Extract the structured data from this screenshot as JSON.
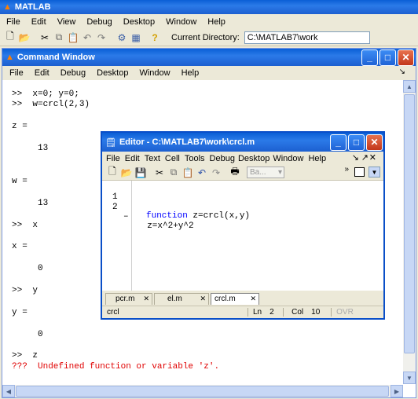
{
  "app": {
    "title": "MATLAB",
    "menu": [
      "File",
      "Edit",
      "View",
      "Debug",
      "Desktop",
      "Window",
      "Help"
    ],
    "current_directory_label": "Current Directory:",
    "current_directory_value": "C:\\MATLAB7\\work"
  },
  "command_window": {
    "title": "Command Window",
    "menu": [
      "File",
      "Edit",
      "Debug",
      "Desktop",
      "Window",
      "Help"
    ],
    "lines": [
      {
        "text": ">>  x=0; y=0;"
      },
      {
        "text": ">>  w=crcl(2,3)"
      },
      {
        "text": "z ="
      },
      {
        "text": "     13"
      },
      {
        "text": "w ="
      },
      {
        "text": "     13"
      },
      {
        "text": ">>  x"
      },
      {
        "text": "x ="
      },
      {
        "text": "     0"
      },
      {
        "text": ">>  y"
      },
      {
        "text": "y ="
      },
      {
        "text": "     0"
      },
      {
        "text": ">>  z"
      },
      {
        "text": "???  Undefined function or variable 'z'."
      }
    ]
  },
  "editor": {
    "title": "Editor - C:\\MATLAB7\\work\\crcl.m",
    "menu": [
      "File",
      "Edit",
      "Text",
      "Cell",
      "Tools",
      "Debug",
      "Desktop",
      "Window",
      "Help"
    ],
    "combo_value": "Ba...",
    "code": [
      {
        "num": "1",
        "mark": "",
        "keyword": "function",
        "rest": " z=crcl(x,y)"
      },
      {
        "num": "2",
        "mark": "–",
        "keyword": "",
        "rest": "  z=x^2+y^2"
      }
    ],
    "tabs": [
      "pcr.m",
      "el.m",
      "crcl.m"
    ],
    "active_tab": "crcl.m",
    "status": {
      "func": "crcl",
      "ln_label": "Ln",
      "ln": "2",
      "col_label": "Col",
      "col": "10",
      "ovr": "OVR"
    }
  },
  "colors": {
    "title_blue": "#0a5fd6",
    "error_red": "#e00000",
    "keyword_blue": "#0000ff"
  }
}
